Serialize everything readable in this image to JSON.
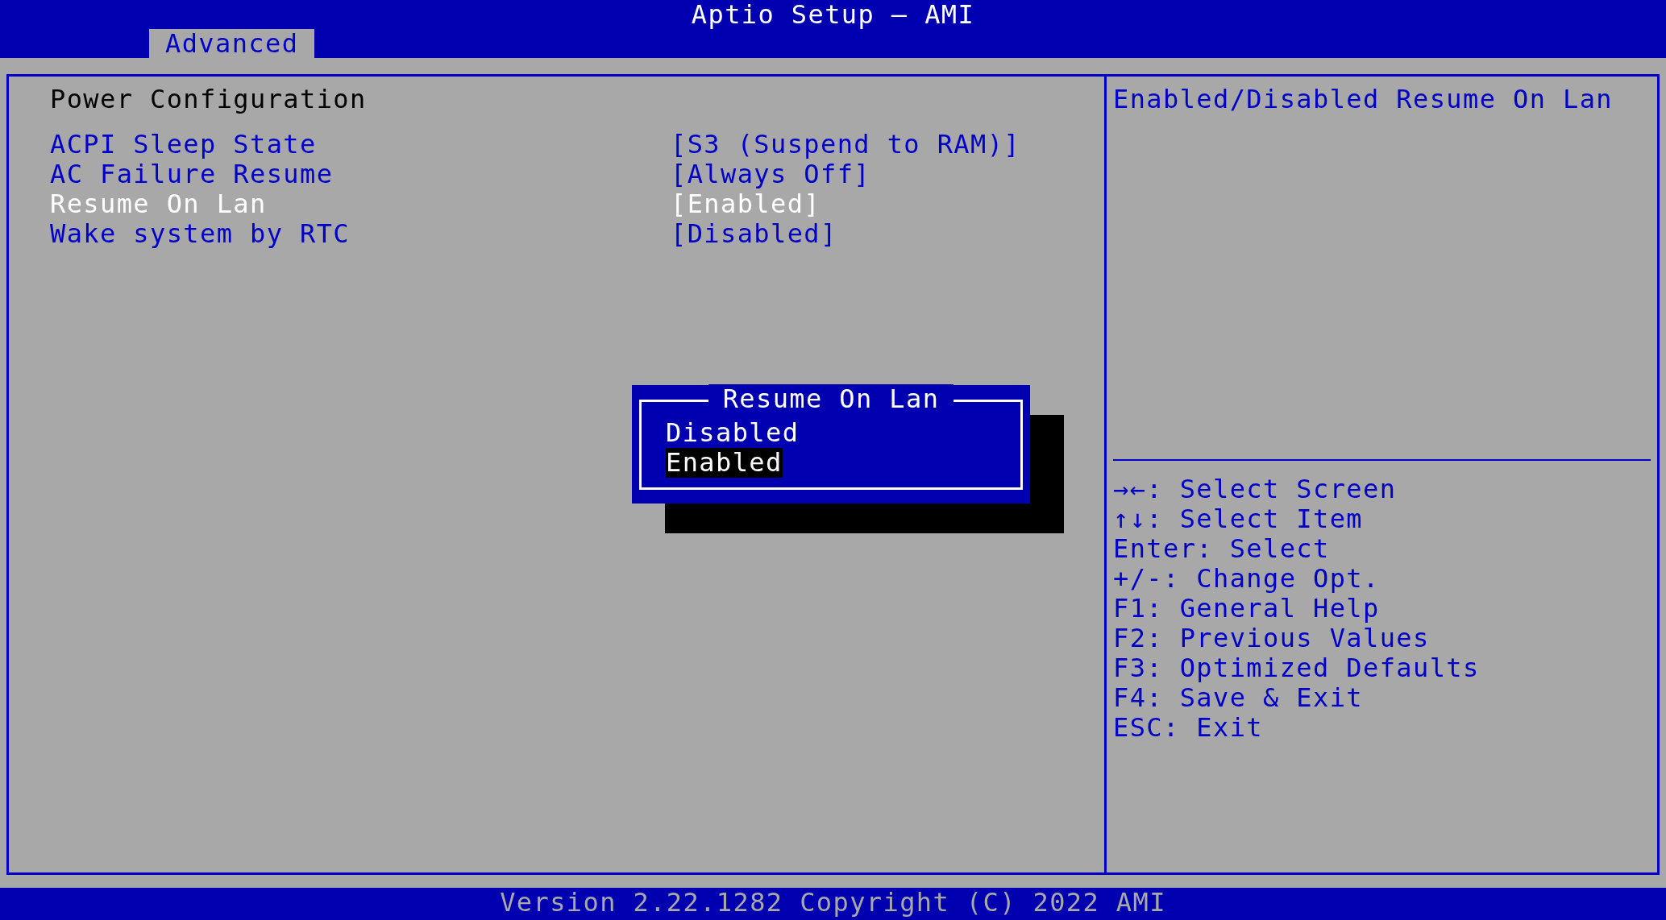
{
  "window": {
    "title": "Aptio Setup – AMI"
  },
  "tabs": [
    {
      "label": "Advanced",
      "selected": true
    }
  ],
  "section_title": "Power Configuration",
  "settings": [
    {
      "label": "ACPI Sleep State",
      "value": "[S3 (Suspend to RAM)]",
      "selected": false
    },
    {
      "label": "AC Failure Resume",
      "value": "[Always Off]",
      "selected": false
    },
    {
      "label": "Resume On Lan",
      "value": "[Enabled]",
      "selected": true
    },
    {
      "label": "Wake system by RTC",
      "value": "[Disabled]",
      "selected": false
    }
  ],
  "help_text": "Enabled/Disabled Resume On Lan",
  "key_help": [
    "→←: Select Screen",
    "↑↓: Select Item",
    "Enter: Select",
    "+/-: Change Opt.",
    "F1: General Help",
    "F2: Previous Values",
    "F3: Optimized Defaults",
    "F4: Save & Exit",
    "ESC: Exit"
  ],
  "popup": {
    "title": "Resume On Lan",
    "options": [
      {
        "label": "Disabled",
        "selected": false
      },
      {
        "label": "Enabled",
        "selected": true
      }
    ]
  },
  "status_bar": "Version 2.22.1282 Copyright (C) 2022 AMI"
}
